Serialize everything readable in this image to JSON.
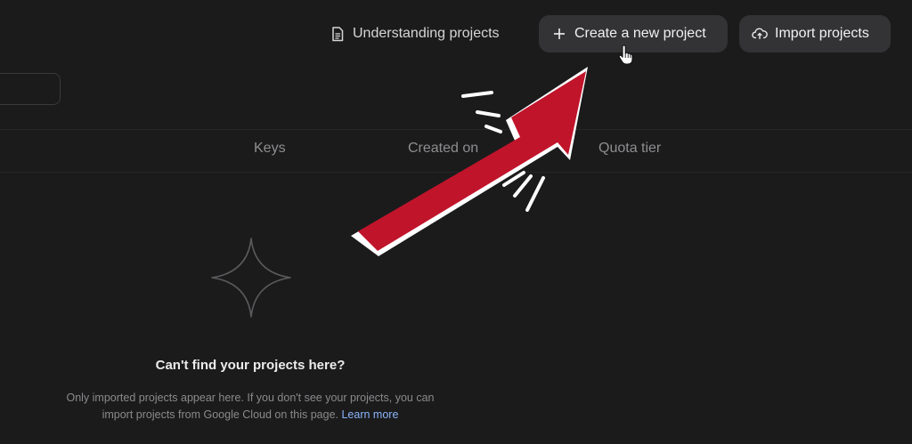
{
  "header": {
    "understanding_label": "Understanding projects",
    "create_label": "Create a new project",
    "import_label": "Import projects"
  },
  "table": {
    "columns": [
      "Keys",
      "Created on",
      "Quota tier"
    ]
  },
  "empty_state": {
    "title": "Can't find your projects here?",
    "text_line1": "Only imported projects appear here. If you don't see your projects, you can",
    "text_line2": "import projects from Google Cloud on this page.",
    "learn_more": "Learn more"
  },
  "icons": {
    "understanding": "document-icon",
    "create": "plus-icon",
    "import": "cloud-upload-icon",
    "empty": "sparkle-icon",
    "cursor": "hand-pointer-icon"
  },
  "colors": {
    "background": "#1b1b1c",
    "button": "#333335",
    "link": "#8ab4f8",
    "overlay_arrow": "#c0142b"
  }
}
